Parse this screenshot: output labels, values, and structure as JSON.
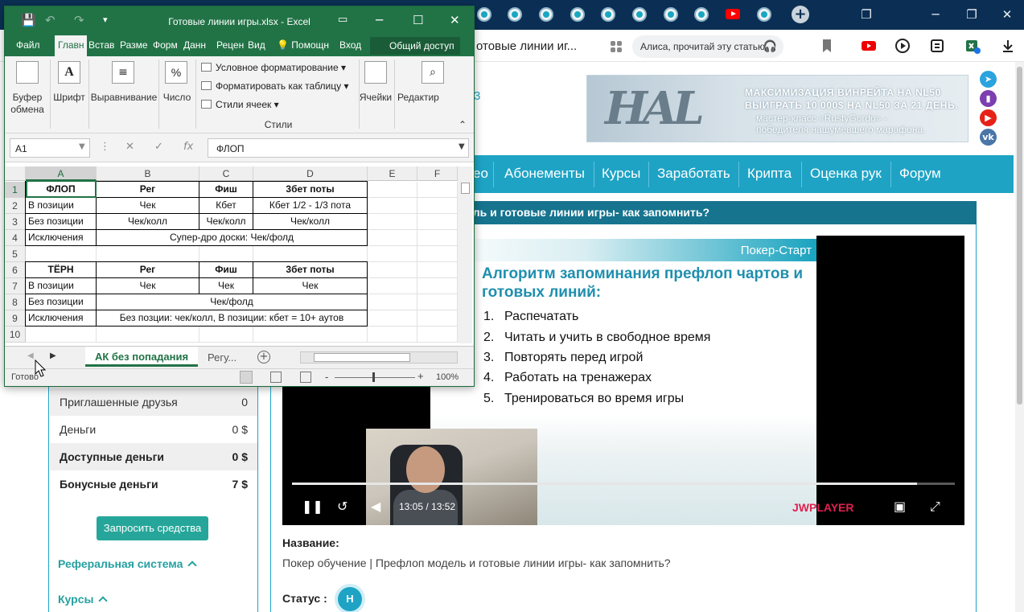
{
  "browser": {
    "address_title": "отовые линии иг...",
    "alice_placeholder": "Алиса, прочитай эту статью",
    "new_tab_symbol": "+",
    "icons": [
      "tab-favicon",
      "youtube-icon",
      "bookmarks-icon",
      "alice-headphones-icon",
      "bookmark-icon",
      "youtube-icon",
      "media-icon",
      "collections-icon",
      "excel-icon",
      "download-icon"
    ]
  },
  "website": {
    "banner": {
      "logo": "HAL",
      "line1": "МАКСИМИЗАЦИЯ ВИНРЕЙТА НА NL50",
      "line2": "ВЫИГРАТЬ 10 000$ НА NL50 ЗА 21 ДЕНЬ.",
      "line3": "мастер-класс «RustyGordo» -",
      "line4": "победителя нашумевшего марафона."
    },
    "orphan_digit": "3",
    "social": [
      {
        "name": "telegram-icon",
        "color": "#2aa3df"
      },
      {
        "name": "twitch-icon",
        "color": "#7b3fb0"
      },
      {
        "name": "youtube-icon",
        "color": "#e62117"
      },
      {
        "name": "vk-icon",
        "color": "#4a76a8"
      }
    ],
    "nav_cut": "ео",
    "nav": [
      "Абонементы",
      "Курсы",
      "Заработать",
      "Крипта",
      "Оценка рук",
      "Форум"
    ],
    "page_heading": "ель и готовые линии игры- как запомнить?",
    "sidebar": {
      "rows": [
        {
          "label": "Приглашенные друзья",
          "value": "0"
        },
        {
          "label": "Деньги",
          "value": "0 $"
        },
        {
          "label": "Доступные деньги",
          "value": "0 $"
        },
        {
          "label": "Бонусные деньги",
          "value": "7 $"
        }
      ],
      "withdraw_button": "Запросить средства",
      "referral_link": "Реферальная система",
      "courses_link": "Курсы"
    },
    "video": {
      "brand": "Покер-Старт",
      "title": "Алгоритм запоминания префлоп чартов и готовых линий:",
      "steps": [
        "Распечатать",
        "Читать и учить в свободное время",
        "Повторять перед игрой",
        "Работать на тренажерах",
        "Тренироваться во время игры"
      ],
      "current_time": "13:05",
      "duration": "13:52",
      "time_separator": "/",
      "progress": 0.943,
      "player_logo": "JWPLAYER"
    },
    "name_label": "Название:",
    "name_value": "Покер обучение | Префлоп модель и готовые линии игры- как запомнить?",
    "status_label": "Статус :",
    "status_badge": "Н"
  },
  "excel": {
    "title": "Готовые линии игры.xlsx  -  Excel",
    "menus": [
      "Файл",
      "Главн",
      "Встав",
      "Разме",
      "Форм",
      "Данн",
      "Рецен",
      "Вид",
      "Помощн",
      "Вход"
    ],
    "share": "Общий доступ",
    "ribbon": {
      "clipboard": [
        "Буфер",
        "обмена"
      ],
      "font": "Шрифт",
      "align": "Выравнивание",
      "number": "Число",
      "number_symbol": "%",
      "cond_format": "Условное форматирование",
      "format_table": "Форматировать как таблицу",
      "cell_styles": "Стили ячеек",
      "styles_group": "Стили",
      "cells": "Ячейки",
      "editing": "Редактир"
    },
    "name_box": "A1",
    "formula_value": "ФЛОП",
    "columns": [
      "A",
      "B",
      "C",
      "D",
      "E",
      "F"
    ],
    "rows": [
      "1",
      "2",
      "3",
      "4",
      "5",
      "6",
      "7",
      "8",
      "9",
      "10"
    ],
    "cells": {
      "r1": [
        "ФЛОП",
        "Рег",
        "Фиш",
        "3бет поты"
      ],
      "r2": [
        "В позиции",
        "Чек",
        "Кбет",
        "Кбет 1/2 - 1/3 пота"
      ],
      "r3": [
        "Без позиции",
        "Чек/колл",
        "Чек/колл",
        "Чек/колл"
      ],
      "r4": [
        "Исключения",
        "Супер-дро доски: Чек/фолд"
      ],
      "r6": [
        "ТЁРН",
        "Рег",
        "Фиш",
        "3бет поты"
      ],
      "r7": [
        "В позиции",
        "Чек",
        "Чек",
        "Чек"
      ],
      "r8": [
        "Без позиции",
        "Чек/фолд"
      ],
      "r9": [
        "Исключения",
        "Без позции: чек/колл, В позиции: кбет = 10+ аутов"
      ]
    },
    "sheet_active": "АК без попадания",
    "sheet_other": "Регу...",
    "status": "Готово",
    "zoom": "100%"
  }
}
